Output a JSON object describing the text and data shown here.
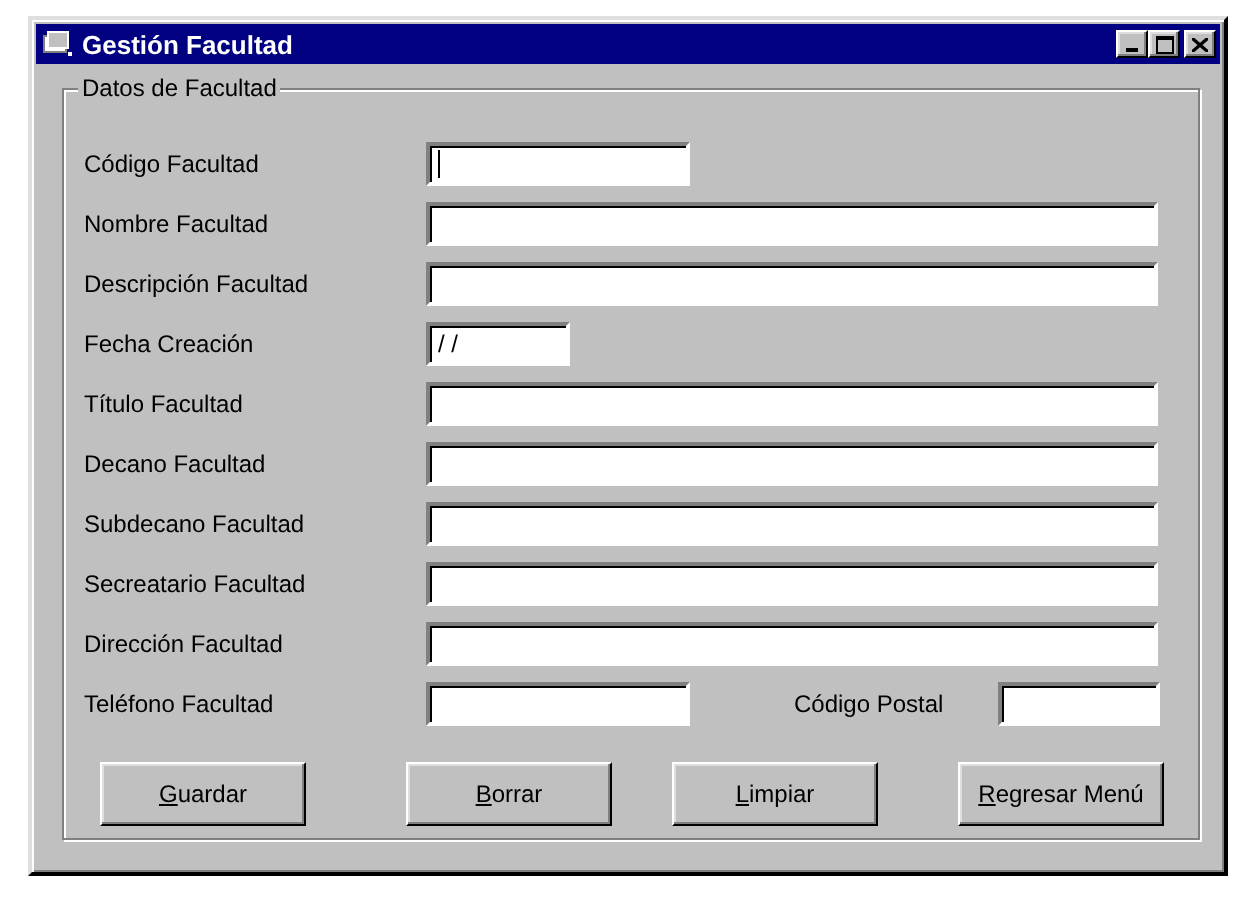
{
  "window": {
    "title": "Gestión Facultad",
    "controls": [
      {
        "kind": "minimize"
      },
      {
        "kind": "maximize"
      },
      {
        "kind": "close"
      }
    ]
  },
  "group": {
    "title": "Datos de Facultad"
  },
  "rows": [
    {
      "label": "Código Facultad",
      "field": {
        "kind": "short",
        "focused": true
      }
    },
    {
      "label": "Nombre Facultad",
      "field": {
        "kind": "wide",
        "focused": false
      }
    },
    {
      "label": "Descripción Facultad",
      "field": {
        "kind": "wide",
        "focused": false
      }
    },
    {
      "label": "Fecha Creación",
      "field": {
        "kind": "date",
        "value": "/ /",
        "focused": false
      }
    },
    {
      "label": "Título Facultad",
      "field": {
        "kind": "wide",
        "focused": false
      }
    },
    {
      "label": "Decano Facultad",
      "field": {
        "kind": "wide",
        "focused": false
      }
    },
    {
      "label": "Subdecano Facultad",
      "field": {
        "kind": "wide",
        "focused": false
      }
    },
    {
      "label": "Secreatario Facultad",
      "field": {
        "kind": "wide",
        "focused": false
      }
    },
    {
      "label": "Dirección Facultad",
      "field": {
        "kind": "wide",
        "focused": false
      }
    },
    {
      "label": "Teléfono Facultad",
      "field": {
        "kind": "short",
        "focused": false
      },
      "extra": {
        "label": "Código Postal",
        "field": {
          "kind": "postal",
          "focused": false
        }
      }
    }
  ],
  "buttons": [
    "Guardar",
    "Borrar",
    "Limpiar",
    "Regresar Menú"
  ]
}
